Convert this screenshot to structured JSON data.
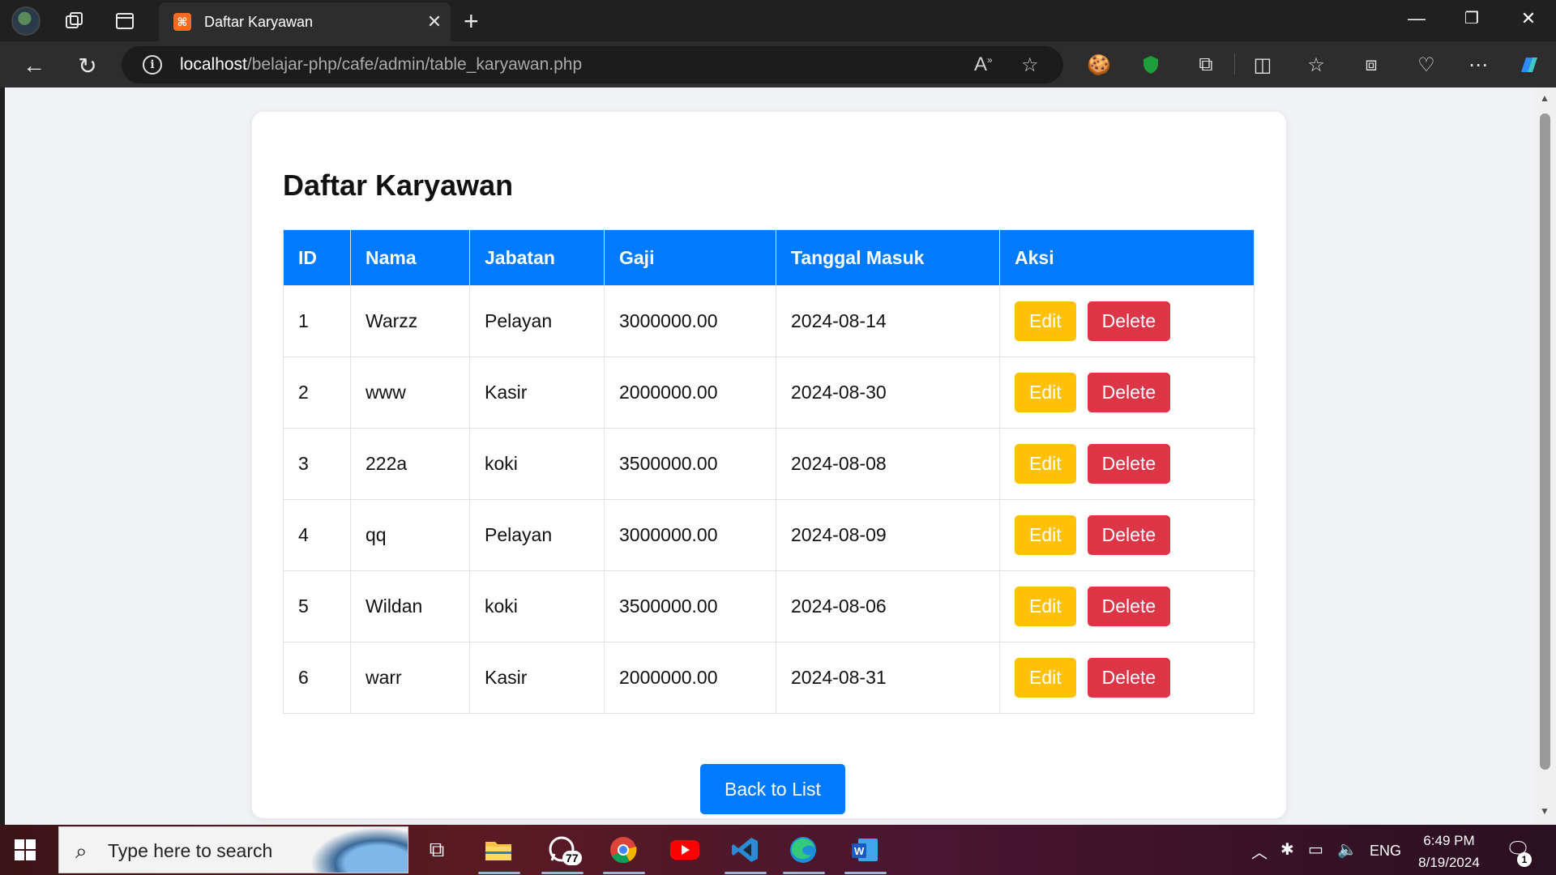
{
  "browser": {
    "tab_title": "Daftar Karyawan",
    "url_host": "localhost",
    "url_path": "/belajar-php/cafe/admin/table_karyawan.php"
  },
  "page": {
    "title": "Daftar Karyawan",
    "columns": [
      "ID",
      "Nama",
      "Jabatan",
      "Gaji",
      "Tanggal Masuk",
      "Aksi"
    ],
    "rows": [
      {
        "id": "1",
        "nama": "Warzz",
        "jabatan": "Pelayan",
        "gaji": "3000000.00",
        "tanggal": "2024-08-14"
      },
      {
        "id": "2",
        "nama": "www",
        "jabatan": "Kasir",
        "gaji": "2000000.00",
        "tanggal": "2024-08-30"
      },
      {
        "id": "3",
        "nama": "222a",
        "jabatan": "koki",
        "gaji": "3500000.00",
        "tanggal": "2024-08-08"
      },
      {
        "id": "4",
        "nama": "qq",
        "jabatan": "Pelayan",
        "gaji": "3000000.00",
        "tanggal": "2024-08-09"
      },
      {
        "id": "5",
        "nama": "Wildan",
        "jabatan": "koki",
        "gaji": "3500000.00",
        "tanggal": "2024-08-06"
      },
      {
        "id": "6",
        "nama": "warr",
        "jabatan": "Kasir",
        "gaji": "2000000.00",
        "tanggal": "2024-08-31"
      }
    ],
    "edit_label": "Edit",
    "delete_label": "Delete",
    "back_label": "Back to List"
  },
  "taskbar": {
    "search_placeholder": "Type here to search",
    "whatsapp_badge": "77",
    "language": "ENG",
    "time": "6:49 PM",
    "date": "8/19/2024",
    "notification_count": "1"
  },
  "colors": {
    "primary": "#007bff",
    "warning": "#ffc107",
    "danger": "#dc3545"
  }
}
